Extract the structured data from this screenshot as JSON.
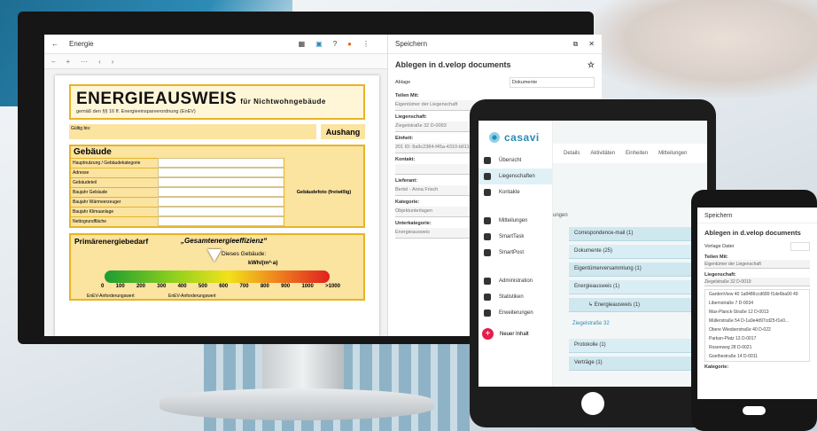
{
  "viewer": {
    "back": "←",
    "title": "Energie",
    "toolbar": [
      "–",
      "+",
      "⋯",
      "‹",
      "›"
    ]
  },
  "doc": {
    "title": "ENERGIEAUSWEIS",
    "title_suffix": "für Nichtwohngebäude",
    "subtitle": "gemäß den §§ 16 ff. Energieeinsparverordnung (EnEV)",
    "valid": "Gültig bis:",
    "aushang": "Aushang",
    "gebaeude_title": "Gebäude",
    "gebaeude_rows": [
      "Hauptnutzung / Gebäudekategorie",
      "Adresse",
      "Gebäudeteil",
      "Baujahr Gebäude",
      "Baujahr Wärmeerzeuger",
      "Baujahr Klimaanlage",
      "Nettogrundfläche"
    ],
    "gebaeudefoto": "Gebäudefoto (freiwillig)",
    "primaer": "Primärenergiebedarf",
    "gesamt": "„Gesamtenergieeffizienz“",
    "dieses": "Dieses Gebäude:",
    "kwh": "kWh/(m²·a)",
    "ticks": [
      "0",
      "100",
      "200",
      "300",
      "400",
      "500",
      "600",
      "700",
      "800",
      "900",
      "1000",
      ">1000"
    ],
    "enev1": "EnEV-Anforderungswert",
    "enev2": "EnEV-Anforderungswert"
  },
  "panel": {
    "header": "Speichern",
    "title": "Ablegen in d.velop documents",
    "ablage_label": "Ablage",
    "ablage_value": "Dokumente",
    "fields": [
      {
        "label": "Teilen Mit:",
        "value": "Eigentümer der Liegenschaft"
      },
      {
        "label": "Liegenschaft:",
        "value": "Ziegelstraße 32 D-0093"
      },
      {
        "label": "Einheit:",
        "value": "201 ID: 8a9c2384-f45a-4310-b611-1f97bea"
      },
      {
        "label": "Kontakt:",
        "value": ""
      },
      {
        "label": "Lieferant:",
        "value": "Bertel - Anna Frisch"
      },
      {
        "label": "Kategorie:",
        "value": "Objektunterlagen"
      },
      {
        "label": "Unterkategorie:",
        "value": "Energieausweis"
      }
    ]
  },
  "tablet": {
    "logo": "casavi",
    "nav": [
      "Übersicht",
      "Liegenschaften",
      "Kontakte",
      "Mitteilungen",
      "SmartTask",
      "SmartPost",
      "Administration",
      "Statistiken",
      "Erweiterungen"
    ],
    "new": "Neuer Inhalt",
    "tabs": [
      "Details",
      "Aktivitäten",
      "Einheiten",
      "Mitteilungen"
    ],
    "section": "ungen",
    "rows": [
      "Correspondence-mail (1)",
      "Dokumente (25)",
      "Eigentümerversammlung (1)",
      "Energieausweis (1)",
      "↳ Energieausweis (1)",
      "Protokolle (1)",
      "Verträge (1)"
    ],
    "link": "Ziegelstraße 32"
  },
  "phone": {
    "header": "Speichern",
    "title": "Ablegen in d.velop documents",
    "vorlage": "Vorlage Datei",
    "teilen": "Teilen Mit:",
    "teilen_value": "Eigentümer der Liegenschaft",
    "lieg": "Liegenschaft:",
    "lieg_value": "Ziegelstraße 32 D-0019",
    "list": [
      "GardenView 40 1a8486ccd689 f1de6ba90 49",
      "Libernstraße 7 D-0034",
      "Max-Planck-Straße 12 D-0013",
      "Müllerstraße 54 D-1a9e4d97cd25-f1e0...",
      "Obere Wiesberstraße 40 D-022",
      "Parkan-Platz 13 D-0017",
      "Rosenweg 28 D-0021",
      "Goethestraße 14 D-0011"
    ],
    "kategorie": "Kategorie:"
  }
}
